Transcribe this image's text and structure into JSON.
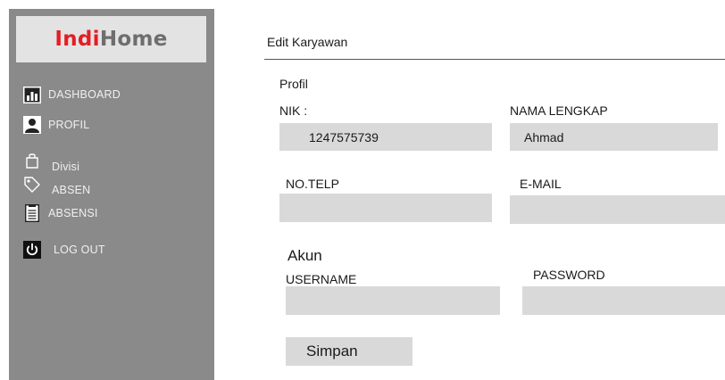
{
  "brand": {
    "part1": "Indi",
    "part2": "Home",
    "accent": "#e31e24",
    "secondary": "#6e6e6e"
  },
  "sidebar": {
    "background": "#8a8a8a",
    "items": [
      {
        "label": "DASHBOARD",
        "icon": "bar-chart-icon"
      },
      {
        "label": "PROFIL",
        "icon": "user-icon"
      },
      {
        "label": "Divisi",
        "icon": "bag-icon"
      },
      {
        "label": "ABSEN",
        "icon": "tag-icon"
      },
      {
        "label": "ABSENSI",
        "icon": "document-icon"
      },
      {
        "label": "LOG OUT",
        "icon": "power-icon"
      }
    ]
  },
  "page": {
    "title": "Edit Karyawan"
  },
  "profile": {
    "section_label": "Profil",
    "nik_label": "NIK :",
    "nik_value": "1247575739",
    "name_label": "NAMA LENGKAP",
    "name_value": "Ahmad",
    "phone_label": "NO.TELP",
    "phone_value": "",
    "email_label": "E-MAIL",
    "email_value": ""
  },
  "account": {
    "section_label": "Akun",
    "username_label": "USERNAME",
    "username_value": "",
    "password_label": "PASSWORD",
    "password_value": ""
  },
  "actions": {
    "save_label": "Simpan"
  },
  "colors": {
    "input_bg": "#d9d9d9"
  }
}
